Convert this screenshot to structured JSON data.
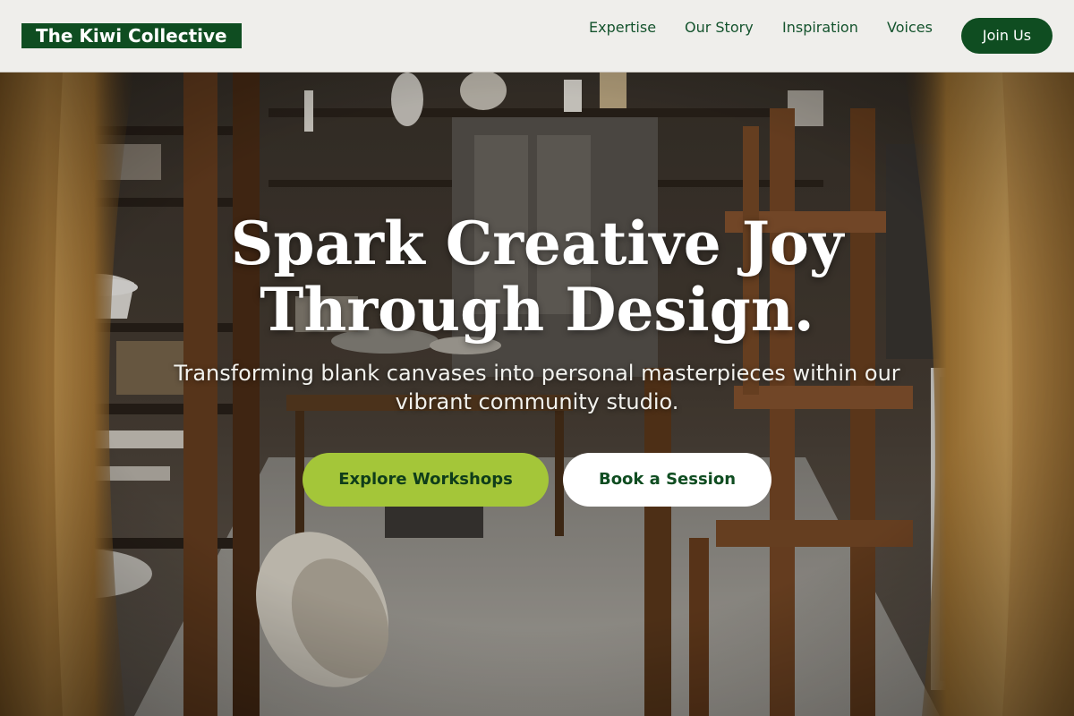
{
  "brand": {
    "name": "The Kiwi Collective"
  },
  "nav": {
    "items": [
      {
        "label": "Expertise"
      },
      {
        "label": "Our Story"
      },
      {
        "label": "Inspiration"
      },
      {
        "label": "Voices"
      }
    ],
    "cta_label": "Join Us"
  },
  "hero": {
    "title": "Spark Creative Joy Through Design.",
    "subtitle": "Transforming blank canvases into personal masterpieces within our vibrant community studio.",
    "primary_cta": "Explore Workshops",
    "secondary_cta": "Book a Session",
    "background_image": "art-studio-photo"
  },
  "colors": {
    "brand_green": "#0f4d21",
    "accent_lime": "#a4c639",
    "header_bg": "#f6f5f2"
  }
}
